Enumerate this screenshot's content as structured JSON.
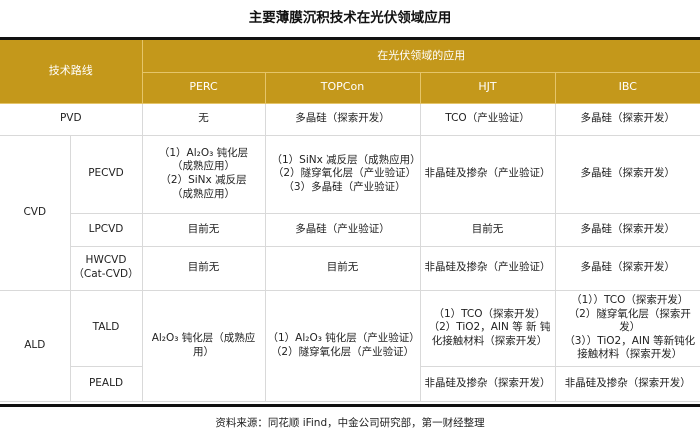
{
  "title": "主要薄膜沉积技术在光伏领域应用",
  "header": {
    "route_label": "技术路线",
    "application_label": "在光伏领域的应用",
    "columns": [
      "PERC",
      "TOPCon",
      "HJT",
      "IBC"
    ]
  },
  "rows": {
    "pvd": {
      "label": "PVD",
      "perc": "无",
      "topcon": "多晶硅（探索开发）",
      "hjt": "TCO（产业验证）",
      "ibc": "多晶硅（探索开发）"
    },
    "cvd": {
      "label": "CVD",
      "pecvd": {
        "label": "PECVD",
        "perc": [
          "（1）Al₂O₃ 钝化层",
          "（成熟应用）",
          "（2）SiNx 减反层",
          "（成熟应用）"
        ],
        "topcon": [
          "（1）SiNx 减反层（成熟应用）",
          "（2）隧穿氧化层（产业验证）",
          "（3）多晶硅（产业验证）"
        ],
        "hjt": "非晶硅及掺杂（产业验证）",
        "ibc": "多晶硅（探索开发）"
      },
      "lpcvd": {
        "label": "LPCVD",
        "perc": "目前无",
        "topcon": "多晶硅（产业验证）",
        "hjt": "目前无",
        "ibc": "多晶硅（探索开发）"
      },
      "hwcvd": {
        "label": [
          "HWCVD",
          "（Cat-CVD）"
        ],
        "perc": "目前无",
        "topcon": "目前无",
        "hjt": "非晶硅及掺杂（产业验证）",
        "ibc": "多晶硅（探索开发）"
      }
    },
    "ald": {
      "label": "ALD",
      "perc_merged": "Al₂O₃ 钝化层（成熟应用）",
      "topcon_merged": [
        "（1）Al₂O₃ 钝化层（产业验证）",
        "（2）隧穿氧化层（产业验证）"
      ],
      "tald": {
        "label": "TALD",
        "hjt": [
          "（1）TCO（探索开发）",
          "（2）TiO2，AIN 等 新 钝",
          "化接触材料（探索开发）"
        ],
        "ibc": [
          "（1））TCO（探索开发）",
          "（2）隧穿氧化层（探索开发）",
          "（3））TiO2，AIN 等新钝化",
          "接触材料（探索开发）"
        ]
      },
      "peald": {
        "label": "PEALD",
        "hjt": "非晶硅及掺杂（探索开发）",
        "ibc": "非晶硅及掺杂（探索开发）"
      }
    }
  },
  "source": "资料来源：同花顺 iFind，中金公司研究部，第一财经整理"
}
